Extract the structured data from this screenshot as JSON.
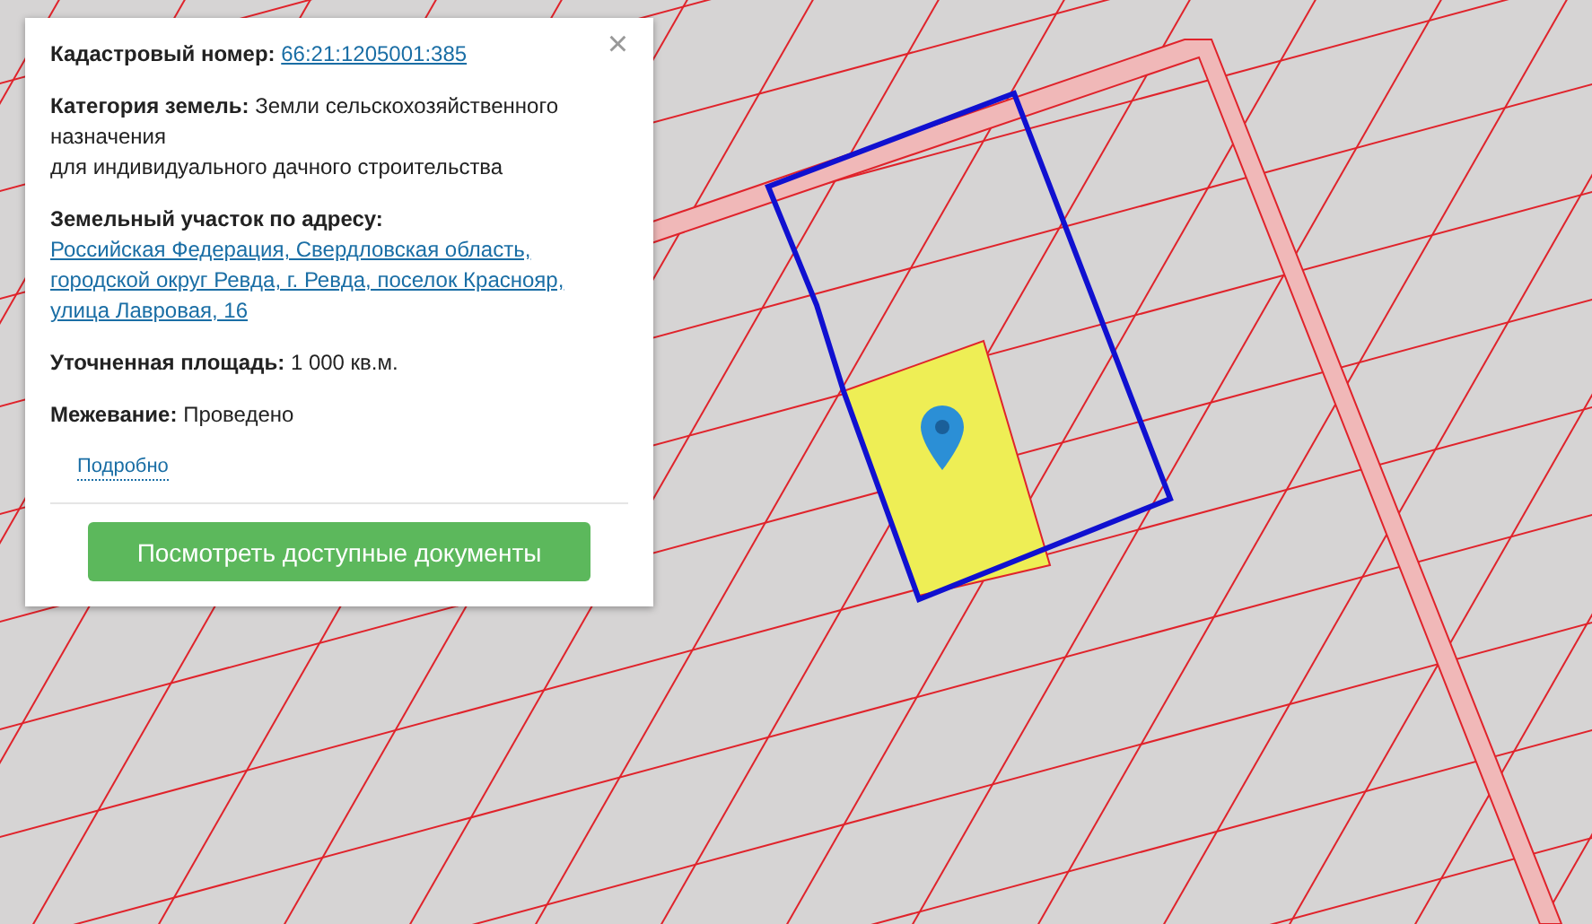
{
  "popup": {
    "close": "×",
    "fields": [
      {
        "label": "Кадастровый номер:",
        "value": "66:21:1205001:385",
        "kind": "link"
      },
      {
        "label": "Категория земель:",
        "value": "Земли сельскохозяйственного назначения\nдля индивидуального дачного строительства",
        "kind": "text"
      },
      {
        "label": "Земельный участок по адресу:",
        "value": "Российская Федерация, Свердловская область, городской округ Ревда, г. Ревда, поселок Краснояр, улица Лавровая, 16",
        "kind": "link"
      },
      {
        "label": "Уточненная площадь:",
        "value": "1 000 кв.м.",
        "kind": "text"
      },
      {
        "label": "Межевание:",
        "value": "Проведено",
        "kind": "text"
      }
    ],
    "more_link": "Подробно",
    "button": "Посмотреть доступные документы"
  }
}
